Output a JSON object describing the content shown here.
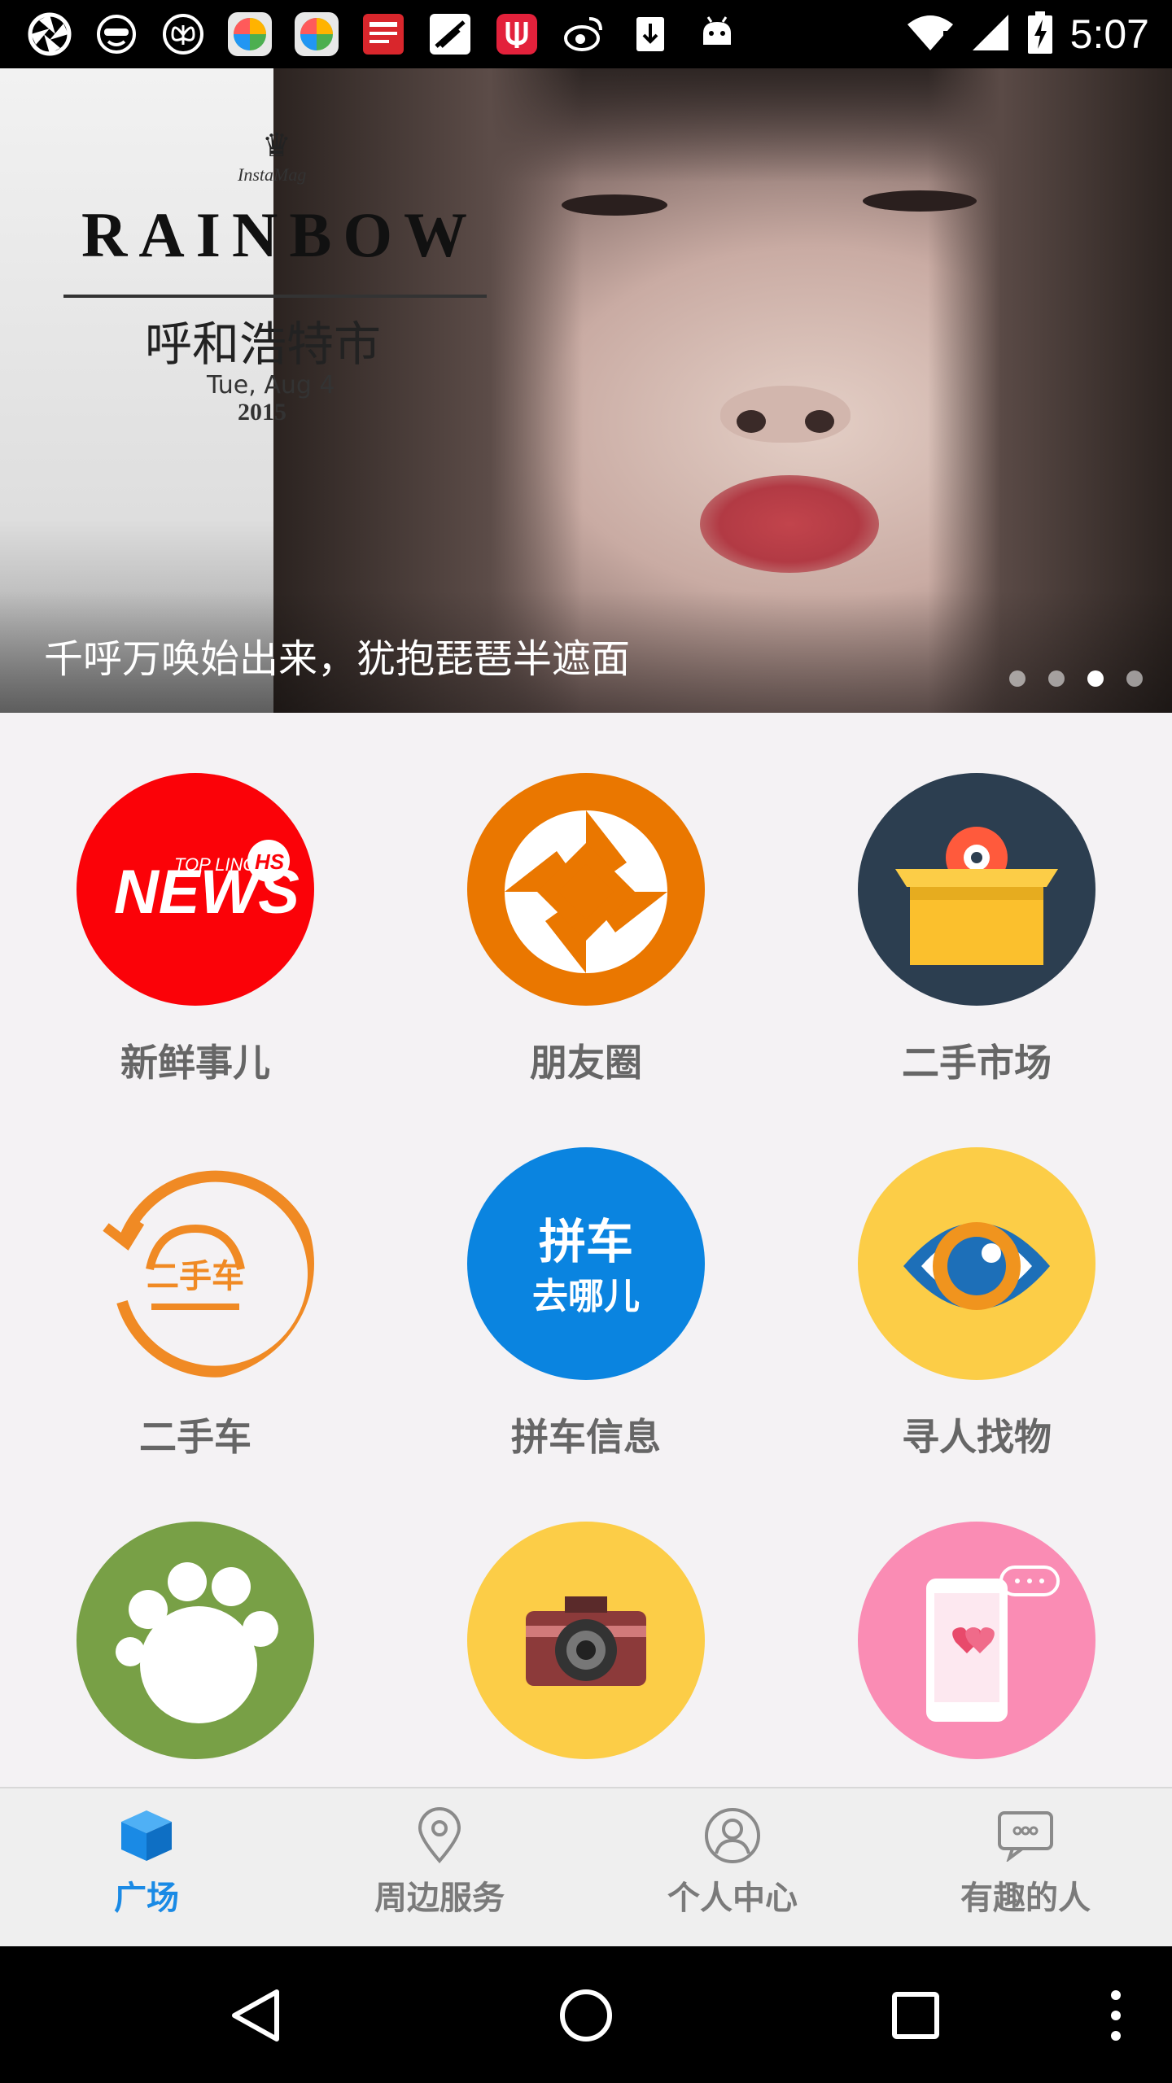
{
  "status_bar": {
    "time": "5:07",
    "notification_icons": [
      "aperture-icon",
      "sunglasses-face-icon",
      "butterfly-icon",
      "color-ball-icon",
      "color-ball-icon",
      "news-box-icon",
      "no-signal-icon",
      "fork-app-icon",
      "weibo-icon",
      "download-icon",
      "android-icon"
    ],
    "system_icons": [
      "wifi-icon",
      "signal-icon",
      "battery-charging-icon"
    ]
  },
  "banner": {
    "logo_brand": "InstaMag",
    "logo_title": "RAINBOW",
    "logo_city": "呼和浩特市",
    "logo_date": "Tue, Aug 4",
    "logo_year": "2015",
    "caption": "千呼万唤始出来，犹抱琵琶半遮面",
    "page_count": 4,
    "active_page": 3
  },
  "grid": {
    "items": [
      {
        "label": "新鲜事儿",
        "icon": "news-icon",
        "color": "#fb0208"
      },
      {
        "label": "朋友圈",
        "icon": "camera-shutter-icon",
        "color": "#ea7700"
      },
      {
        "label": "二手市场",
        "icon": "box-gear-icon",
        "color": "#2c3e50"
      },
      {
        "label": "二手车",
        "icon": "used-car-icon",
        "color": "#f08a24"
      },
      {
        "label": "拼车信息",
        "icon": "carpool-icon",
        "color": "#0a84e0"
      },
      {
        "label": "寻人找物",
        "icon": "eye-icon",
        "color": "#fccd47"
      },
      {
        "label": "",
        "icon": "paw-icon",
        "color": "#78a046"
      },
      {
        "label": "",
        "icon": "photo-camera-icon",
        "color": "#fccd47"
      },
      {
        "label": "",
        "icon": "phone-heart-icon",
        "color": "#fa8cb4"
      }
    ],
    "news_badge_text": "NEWS",
    "news_sub_text": "TOP LING",
    "news_hs": "HS",
    "carpool_line1": "拼车",
    "carpool_line2": "去哪儿",
    "usedcar_text": "二手车"
  },
  "tabbar": {
    "tabs": [
      {
        "label": "广场",
        "icon": "cube-icon",
        "active": true
      },
      {
        "label": "周边服务",
        "icon": "location-pin-icon",
        "active": false
      },
      {
        "label": "个人中心",
        "icon": "person-icon",
        "active": false
      },
      {
        "label": "有趣的人",
        "icon": "chat-bubble-icon",
        "active": false
      }
    ],
    "active_color": "#1a8ae5",
    "inactive_color": "#7a7a7a"
  },
  "navbar": {
    "buttons": [
      "back-icon",
      "home-icon",
      "recents-icon",
      "menu-dots-icon"
    ]
  }
}
